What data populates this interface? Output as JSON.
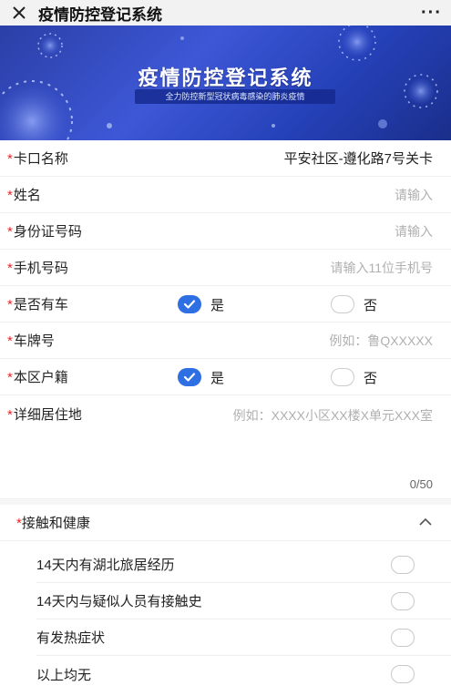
{
  "topbar": {
    "close_icon": "close-icon",
    "title": "疫情防控登记系统",
    "more_label": "···"
  },
  "banner": {
    "title": "疫情防控登记系统",
    "subtitle": "全力防控新型冠状病毒感染的肺炎疫情"
  },
  "form": {
    "checkpoint": {
      "label": "卡口名称",
      "value": "平安社区-遵化路7号关卡"
    },
    "name": {
      "label": "姓名",
      "placeholder": "请输入"
    },
    "id_number": {
      "label": "身份证号码",
      "placeholder": "请输入"
    },
    "phone": {
      "label": "手机号码",
      "placeholder": "请输入11位手机号"
    },
    "has_car": {
      "label": "是否有车",
      "yes": "是",
      "no": "否",
      "selected": "是"
    },
    "plate": {
      "label": "车牌号",
      "placeholder": "例如：鲁QXXXXX"
    },
    "local_household": {
      "label": "本区户籍",
      "yes": "是",
      "no": "否",
      "selected": "是"
    },
    "address": {
      "label": "详细居住地",
      "placeholder": "例如：XXXX小区XX楼X单元XXX室",
      "counter": "0/50"
    }
  },
  "health": {
    "label": "接触和健康",
    "items": [
      "14天内有湖北旅居经历",
      "14天内与疑似人员有接触史",
      "有发热症状",
      "以上均无"
    ]
  },
  "colors": {
    "accent": "#2f6fe4",
    "required": "#e22222",
    "banner": "#3d57d6"
  }
}
